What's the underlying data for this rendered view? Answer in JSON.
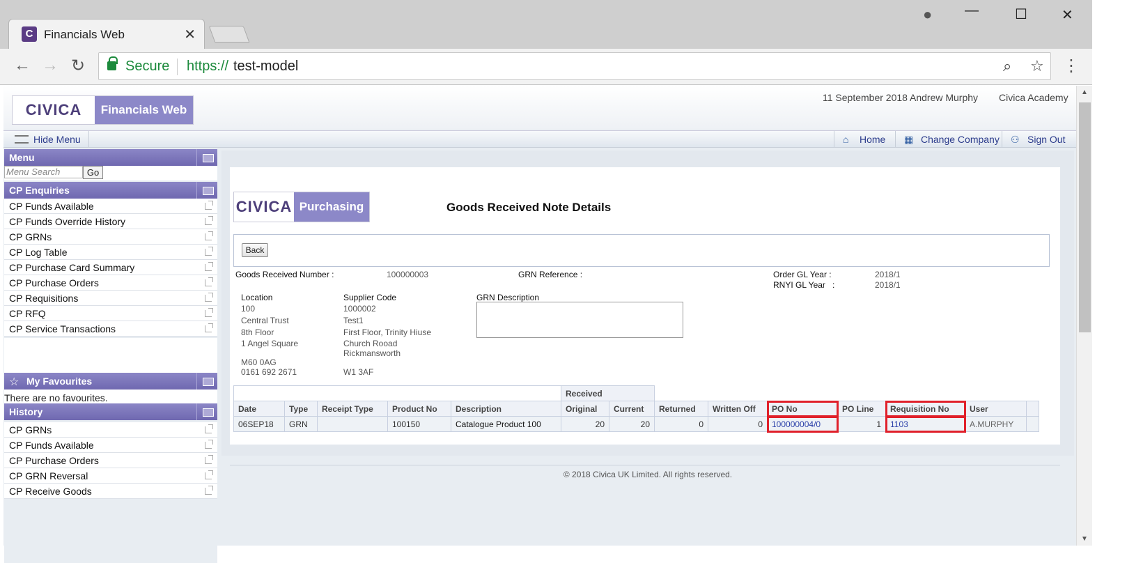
{
  "browser": {
    "tab_title": "Financials Web",
    "tab_favicon": "C",
    "close_glyph": "✕",
    "secure_label": "Secure",
    "url_protocol": "https://",
    "url_host": "test-model",
    "back_glyph": "←",
    "forward_glyph": "→",
    "reload_glyph": "↻",
    "zoom_glyph": "⌕",
    "star_glyph": "☆",
    "menu_glyph": "⋮",
    "minimize_glyph": "—",
    "maximize_glyph": "☐",
    "window_close_glyph": "✕",
    "profile_glyph": "●"
  },
  "header": {
    "logo_civica": "CIVICA",
    "logo_app": "Financials Web",
    "date": "11 September 2018",
    "user": "Andrew Murphy",
    "company": "Civica Academy"
  },
  "menubar": {
    "hide_menu": "Hide Menu",
    "home": "Home",
    "change_company": "Change Company",
    "sign_out": "Sign Out"
  },
  "sidebar": {
    "menu_title": "Menu",
    "search_placeholder": "Menu Search",
    "go_label": "Go",
    "enquiries_title": "CP Enquiries",
    "enquiries": [
      "CP Funds Available",
      "CP Funds Override History",
      "CP GRNs",
      "CP Log Table",
      "CP Purchase Card Summary",
      "CP Purchase Orders",
      "CP Requisitions",
      "CP RFQ",
      "CP Service Transactions"
    ],
    "favourites_title": "My Favourites",
    "no_favourites": "There are no favourites.",
    "history_title": "History",
    "history": [
      "CP GRNs",
      "CP Funds Available",
      "CP Purchase Orders",
      "CP GRN Reversal",
      "CP Receive Goods"
    ]
  },
  "page": {
    "logo_civica": "CIVICA",
    "logo_module": "Purchasing",
    "title": "Goods Received Note Details",
    "back_label": "Back",
    "grn_number_label": "Goods Received Number :",
    "grn_number_value": "100000003",
    "grn_reference_label": "GRN Reference :",
    "order_gl_year_label": "Order GL Year :",
    "order_gl_year_value": "2018/1",
    "rnyi_gl_year_label": "RNYI GL Year",
    "rnyi_colon": ":",
    "rnyi_gl_year_value": "2018/1",
    "location_label": "Location",
    "location_lines": [
      "100",
      "Central Trust",
      "8th Floor",
      "1 Angel Square",
      "M60 0AG",
      "0161 692 2671"
    ],
    "supplier_label": "Supplier Code",
    "supplier_lines": [
      "1000002",
      "Test1",
      "First Floor, Trinity Hiuse",
      "Church Rooad",
      "Rickmansworth",
      "W1 3AF"
    ],
    "grn_description_label": "GRN Description"
  },
  "table": {
    "group_header": "Received",
    "columns": [
      "Date",
      "Type",
      "Receipt Type",
      "Product No",
      "Description",
      "Original",
      "Current",
      "Returned",
      "Written Off",
      "PO No",
      "PO Line",
      "Requisition No",
      "User"
    ],
    "rows": [
      {
        "date": "06SEP18",
        "type": "GRN",
        "receipt_type": "",
        "product_no": "100150",
        "description": "Catalogue Product 100",
        "original": "20",
        "current": "20",
        "returned": "0",
        "written_off": "0",
        "po_no": "100000004/0",
        "po_line": "1",
        "requisition_no": "1103",
        "user": "A.MURPHY"
      }
    ]
  },
  "footer": {
    "copyright": "© 2018 Civica UK Limited. All rights reserved."
  },
  "colors": {
    "brand_purple": "#8c88c8",
    "panel_header": "#6f68b0",
    "highlight_red": "#e0202a",
    "link_blue": "#2b3fa8",
    "secure_green": "#1c8a3c"
  }
}
